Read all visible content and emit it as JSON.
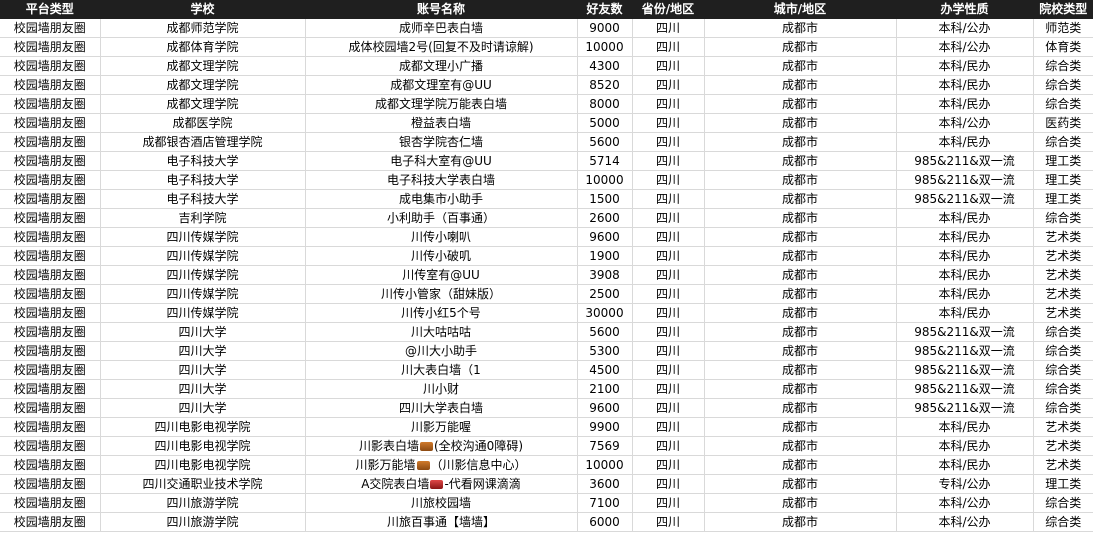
{
  "headers": [
    "平台类型",
    "学校",
    "账号名称",
    "好友数",
    "省份/地区",
    "城市/地区",
    "办学性质",
    "院校类型"
  ],
  "rows": [
    {
      "platform": "校园墙朋友圈",
      "school": "成都师范学院",
      "account_pre": "成师辛巴表白墙",
      "icon": "",
      "account_post": "",
      "friends": "9000",
      "province": "四川",
      "city": "成都市",
      "nature": "本科/公办",
      "type": "师范类"
    },
    {
      "platform": "校园墙朋友圈",
      "school": "成都体育学院",
      "account_pre": "成体校园墙2号(回复不及时请谅解)",
      "icon": "",
      "account_post": "",
      "friends": "10000",
      "province": "四川",
      "city": "成都市",
      "nature": "本科/公办",
      "type": "体育类"
    },
    {
      "platform": "校园墙朋友圈",
      "school": "成都文理学院",
      "account_pre": "成都文理小广播",
      "icon": "",
      "account_post": "",
      "friends": "4300",
      "province": "四川",
      "city": "成都市",
      "nature": "本科/民办",
      "type": "综合类"
    },
    {
      "platform": "校园墙朋友圈",
      "school": "成都文理学院",
      "account_pre": "成都文理室有@UU",
      "icon": "",
      "account_post": "",
      "friends": "8520",
      "province": "四川",
      "city": "成都市",
      "nature": "本科/民办",
      "type": "综合类"
    },
    {
      "platform": "校园墙朋友圈",
      "school": "成都文理学院",
      "account_pre": "成都文理学院万能表白墙",
      "icon": "",
      "account_post": "",
      "friends": "8000",
      "province": "四川",
      "city": "成都市",
      "nature": "本科/民办",
      "type": "综合类"
    },
    {
      "platform": "校园墙朋友圈",
      "school": "成都医学院",
      "account_pre": "橙益表白墙",
      "icon": "",
      "account_post": "",
      "friends": "5000",
      "province": "四川",
      "city": "成都市",
      "nature": "本科/公办",
      "type": "医药类"
    },
    {
      "platform": "校园墙朋友圈",
      "school": "成都银杏酒店管理学院",
      "account_pre": "银杏学院杏仁墙",
      "icon": "",
      "account_post": "",
      "friends": "5600",
      "province": "四川",
      "city": "成都市",
      "nature": "本科/民办",
      "type": "综合类"
    },
    {
      "platform": "校园墙朋友圈",
      "school": "电子科技大学",
      "account_pre": "电子科大室有@UU",
      "icon": "",
      "account_post": "",
      "friends": "5714",
      "province": "四川",
      "city": "成都市",
      "nature": "985&211&双一流",
      "type": "理工类"
    },
    {
      "platform": "校园墙朋友圈",
      "school": "电子科技大学",
      "account_pre": "电子科技大学表白墙",
      "icon": "",
      "account_post": "",
      "friends": "10000",
      "province": "四川",
      "city": "成都市",
      "nature": "985&211&双一流",
      "type": "理工类"
    },
    {
      "platform": "校园墙朋友圈",
      "school": "电子科技大学",
      "account_pre": "成电集市小助手",
      "icon": "",
      "account_post": "",
      "friends": "1500",
      "province": "四川",
      "city": "成都市",
      "nature": "985&211&双一流",
      "type": "理工类"
    },
    {
      "platform": "校园墙朋友圈",
      "school": "吉利学院",
      "account_pre": "小利助手（百事通）",
      "icon": "",
      "account_post": "",
      "friends": "2600",
      "province": "四川",
      "city": "成都市",
      "nature": "本科/民办",
      "type": "综合类"
    },
    {
      "platform": "校园墙朋友圈",
      "school": "四川传媒学院",
      "account_pre": "川传小喇叭",
      "icon": "",
      "account_post": "",
      "friends": "9600",
      "province": "四川",
      "city": "成都市",
      "nature": "本科/民办",
      "type": "艺术类"
    },
    {
      "platform": "校园墙朋友圈",
      "school": "四川传媒学院",
      "account_pre": "川传小破叽",
      "icon": "",
      "account_post": "",
      "friends": "1900",
      "province": "四川",
      "city": "成都市",
      "nature": "本科/民办",
      "type": "艺术类"
    },
    {
      "platform": "校园墙朋友圈",
      "school": "四川传媒学院",
      "account_pre": "川传室有@UU",
      "icon": "",
      "account_post": "",
      "friends": "3908",
      "province": "四川",
      "city": "成都市",
      "nature": "本科/民办",
      "type": "艺术类"
    },
    {
      "platform": "校园墙朋友圈",
      "school": "四川传媒学院",
      "account_pre": "川传小管家（甜妹版）",
      "icon": "",
      "account_post": "",
      "friends": "2500",
      "province": "四川",
      "city": "成都市",
      "nature": "本科/民办",
      "type": "艺术类"
    },
    {
      "platform": "校园墙朋友圈",
      "school": "四川传媒学院",
      "account_pre": "川传小红5个号",
      "icon": "",
      "account_post": "",
      "friends": "30000",
      "province": "四川",
      "city": "成都市",
      "nature": "本科/民办",
      "type": "艺术类"
    },
    {
      "platform": "校园墙朋友圈",
      "school": "四川大学",
      "account_pre": "川大咕咕咕",
      "icon": "",
      "account_post": "",
      "friends": "5600",
      "province": "四川",
      "city": "成都市",
      "nature": "985&211&双一流",
      "type": "综合类"
    },
    {
      "platform": "校园墙朋友圈",
      "school": "四川大学",
      "account_pre": "@川大小助手",
      "icon": "",
      "account_post": "",
      "friends": "5300",
      "province": "四川",
      "city": "成都市",
      "nature": "985&211&双一流",
      "type": "综合类"
    },
    {
      "platform": "校园墙朋友圈",
      "school": "四川大学",
      "account_pre": "川大表白墙（1",
      "icon": "",
      "account_post": "",
      "friends": "4500",
      "province": "四川",
      "city": "成都市",
      "nature": "985&211&双一流",
      "type": "综合类"
    },
    {
      "platform": "校园墙朋友圈",
      "school": "四川大学",
      "account_pre": "川小财",
      "icon": "",
      "account_post": "",
      "friends": "2100",
      "province": "四川",
      "city": "成都市",
      "nature": "985&211&双一流",
      "type": "综合类"
    },
    {
      "platform": "校园墙朋友圈",
      "school": "四川大学",
      "account_pre": "四川大学表白墙",
      "icon": "",
      "account_post": "",
      "friends": "9600",
      "province": "四川",
      "city": "成都市",
      "nature": "985&211&双一流",
      "type": "综合类"
    },
    {
      "platform": "校园墙朋友圈",
      "school": "四川电影电视学院",
      "account_pre": "川影万能喔",
      "icon": "",
      "account_post": "",
      "friends": "9900",
      "province": "四川",
      "city": "成都市",
      "nature": "本科/民办",
      "type": "艺术类"
    },
    {
      "platform": "校园墙朋友圈",
      "school": "四川电影电视学院",
      "account_pre": "川影表白墙",
      "icon": "brown",
      "account_post": "(全校沟通0障碍)",
      "friends": "7569",
      "province": "四川",
      "city": "成都市",
      "nature": "本科/民办",
      "type": "艺术类"
    },
    {
      "platform": "校园墙朋友圈",
      "school": "四川电影电视学院",
      "account_pre": "川影万能墙",
      "icon": "brown",
      "account_post": "（川影信息中心）",
      "friends": "10000",
      "province": "四川",
      "city": "成都市",
      "nature": "本科/民办",
      "type": "艺术类"
    },
    {
      "platform": "校园墙朋友圈",
      "school": "四川交通职业技术学院",
      "account_pre": "A交院表白墙",
      "icon": "red",
      "account_post": "-代看网课滴滴",
      "friends": "3600",
      "province": "四川",
      "city": "成都市",
      "nature": "专科/公办",
      "type": "理工类"
    },
    {
      "platform": "校园墙朋友圈",
      "school": "四川旅游学院",
      "account_pre": "川旅校园墙",
      "icon": "",
      "account_post": "",
      "friends": "7100",
      "province": "四川",
      "city": "成都市",
      "nature": "本科/公办",
      "type": "综合类"
    },
    {
      "platform": "校园墙朋友圈",
      "school": "四川旅游学院",
      "account_pre": "川旅百事通【墙墙】",
      "icon": "",
      "account_post": "",
      "friends": "6000",
      "province": "四川",
      "city": "成都市",
      "nature": "本科/公办",
      "type": "综合类"
    }
  ]
}
